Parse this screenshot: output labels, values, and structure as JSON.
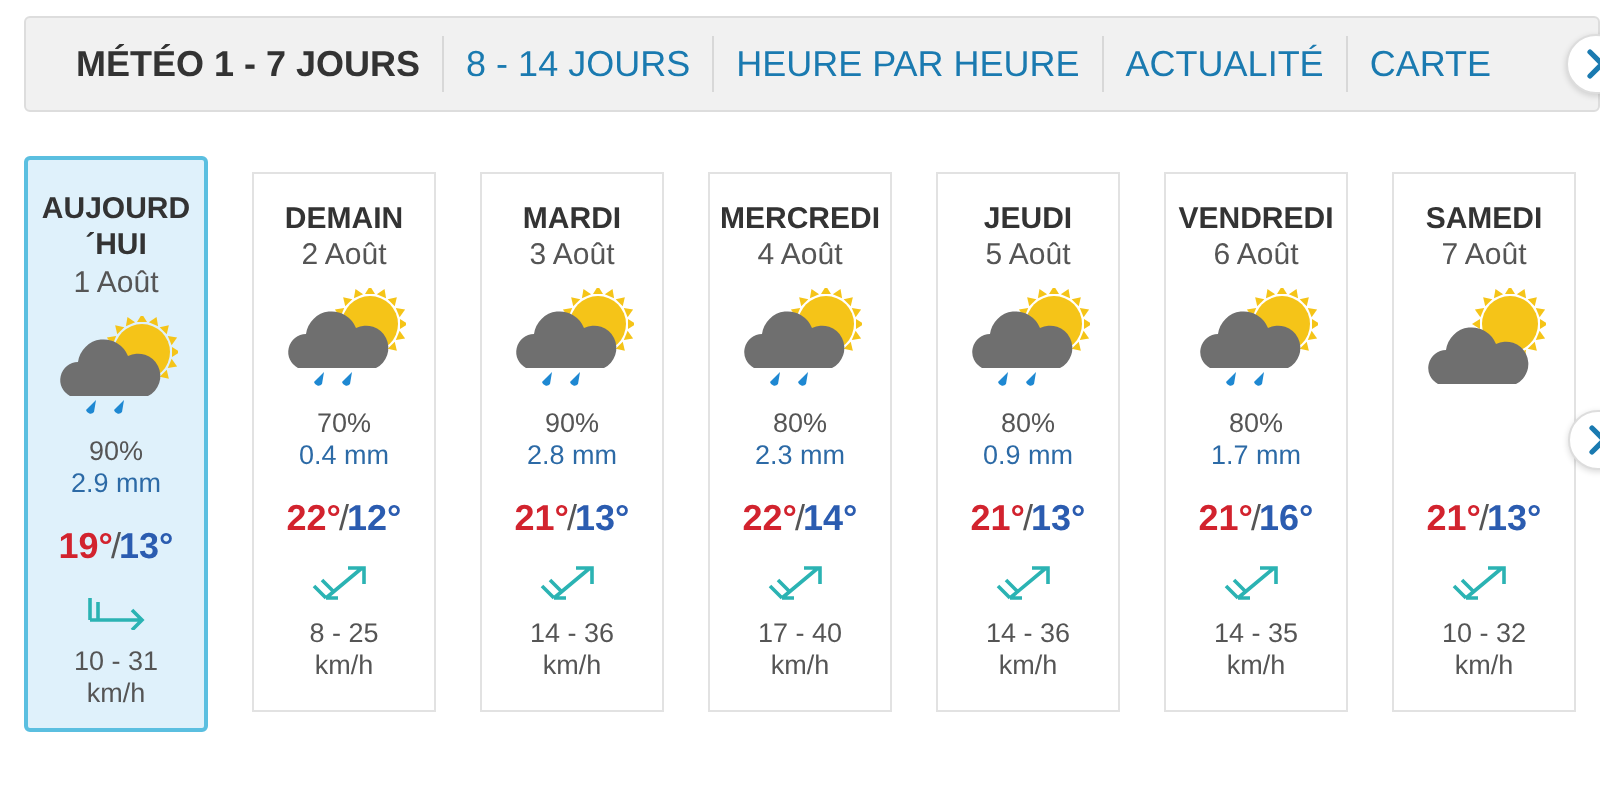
{
  "tabs": [
    {
      "label": "MÉTÉO 1 - 7 JOURS",
      "selected": true
    },
    {
      "label": "8 - 14 JOURS",
      "selected": false
    },
    {
      "label": "HEURE PAR HEURE",
      "selected": false
    },
    {
      "label": "ACTUALITÉ",
      "selected": false
    },
    {
      "label": "CARTE",
      "selected": false
    }
  ],
  "days": [
    {
      "day": "AUJOURD´HUI",
      "date": "1 Août",
      "selected": true,
      "rain": true,
      "probability": "90%",
      "amount": "2.9 mm",
      "high": "19°",
      "slash": "/",
      "low": "13°",
      "wind_arrow": {
        "kind": "east"
      },
      "wind": "10 - 31",
      "unit": "km/h"
    },
    {
      "day": "DEMAIN",
      "date": "2 Août",
      "selected": false,
      "rain": true,
      "probability": "70%",
      "amount": "0.4 mm",
      "high": "22°",
      "slash": "/",
      "low": "12°",
      "wind_arrow": {
        "kind": "northeast"
      },
      "wind": "8 - 25",
      "unit": "km/h"
    },
    {
      "day": "MARDI",
      "date": "3 Août",
      "selected": false,
      "rain": true,
      "probability": "90%",
      "amount": "2.8 mm",
      "high": "21°",
      "slash": "/",
      "low": "13°",
      "wind_arrow": {
        "kind": "northeast"
      },
      "wind": "14 - 36",
      "unit": "km/h"
    },
    {
      "day": "MERCREDI",
      "date": "4 Août",
      "selected": false,
      "rain": true,
      "probability": "80%",
      "amount": "2.3 mm",
      "high": "22°",
      "slash": "/",
      "low": "14°",
      "wind_arrow": {
        "kind": "northeast"
      },
      "wind": "17 - 40",
      "unit": "km/h"
    },
    {
      "day": "JEUDI",
      "date": "5 Août",
      "selected": false,
      "rain": true,
      "probability": "80%",
      "amount": "0.9 mm",
      "high": "21°",
      "slash": "/",
      "low": "13°",
      "wind_arrow": {
        "kind": "northeast"
      },
      "wind": "14 - 36",
      "unit": "km/h"
    },
    {
      "day": "VENDREDI",
      "date": "6 Août",
      "selected": false,
      "rain": true,
      "probability": "80%",
      "amount": "1.7 mm",
      "high": "21°",
      "slash": "/",
      "low": "16°",
      "wind_arrow": {
        "kind": "northeast"
      },
      "wind": "14 - 35",
      "unit": "km/h"
    },
    {
      "day": "SAMEDI",
      "date": "7 Août",
      "selected": false,
      "rain": false,
      "high": "21°",
      "slash": "/",
      "low": "13°",
      "wind_arrow": {
        "kind": "northeast"
      },
      "wind": "10 - 32",
      "unit": "km/h"
    }
  ]
}
